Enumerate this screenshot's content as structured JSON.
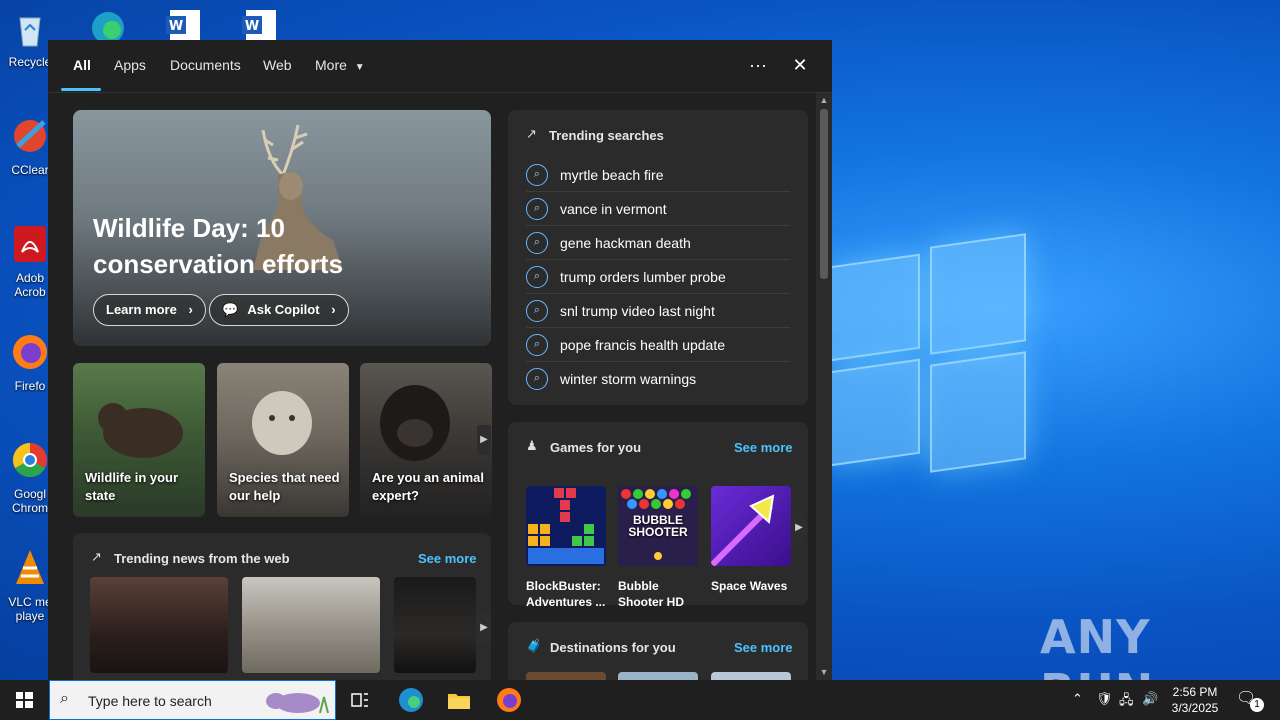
{
  "desktop": {
    "icons": [
      {
        "label": "Recycle",
        "icon": "recycle-bin-icon"
      },
      {
        "label": "CClear",
        "icon": "ccleaner-icon"
      },
      {
        "label": "Adob Acrob",
        "icon": "acrobat-icon"
      },
      {
        "label": "Firefo",
        "icon": "firefox-icon"
      },
      {
        "label": "Googl Chrom",
        "icon": "chrome-icon"
      },
      {
        "label": "VLC me playe",
        "icon": "vlc-icon"
      }
    ],
    "watermark": "ANY RUN"
  },
  "search_panel": {
    "tabs": [
      {
        "label": "All",
        "active": true
      },
      {
        "label": "Apps"
      },
      {
        "label": "Documents"
      },
      {
        "label": "Web"
      },
      {
        "label": "More"
      }
    ],
    "more_label": "More",
    "options_glyph": "···",
    "close_glyph": "✕",
    "hero": {
      "title": "Wildlife Day: 10 conservation efforts",
      "learn_more": "Learn more",
      "ask_copilot": "Ask Copilot"
    },
    "cards": [
      {
        "label": "Wildlife in your state"
      },
      {
        "label": "Species that need our help"
      },
      {
        "label": "Are you an animal expert?"
      }
    ],
    "trending_searches": {
      "title": "Trending searches",
      "items": [
        "myrtle beach fire",
        "vance in vermont",
        "gene hackman death",
        "trump orders lumber probe",
        "snl trump video last night",
        "pope francis health update",
        "winter storm warnings"
      ]
    },
    "games": {
      "title": "Games for you",
      "see_more": "See more",
      "items": [
        {
          "name": "BlockBuster: Adventures ..."
        },
        {
          "name": "Bubble Shooter HD",
          "thumb_text": "BUBBLE SHOOTER"
        },
        {
          "name": "Space Waves"
        }
      ]
    },
    "trending_news": {
      "title": "Trending news from the web",
      "see_more": "See more"
    },
    "destinations": {
      "title": "Destinations for you",
      "see_more": "See more"
    }
  },
  "taskbar": {
    "search_placeholder": "Type here to search",
    "time": "2:56 PM",
    "date": "3/3/2025",
    "notification_count": "1"
  }
}
